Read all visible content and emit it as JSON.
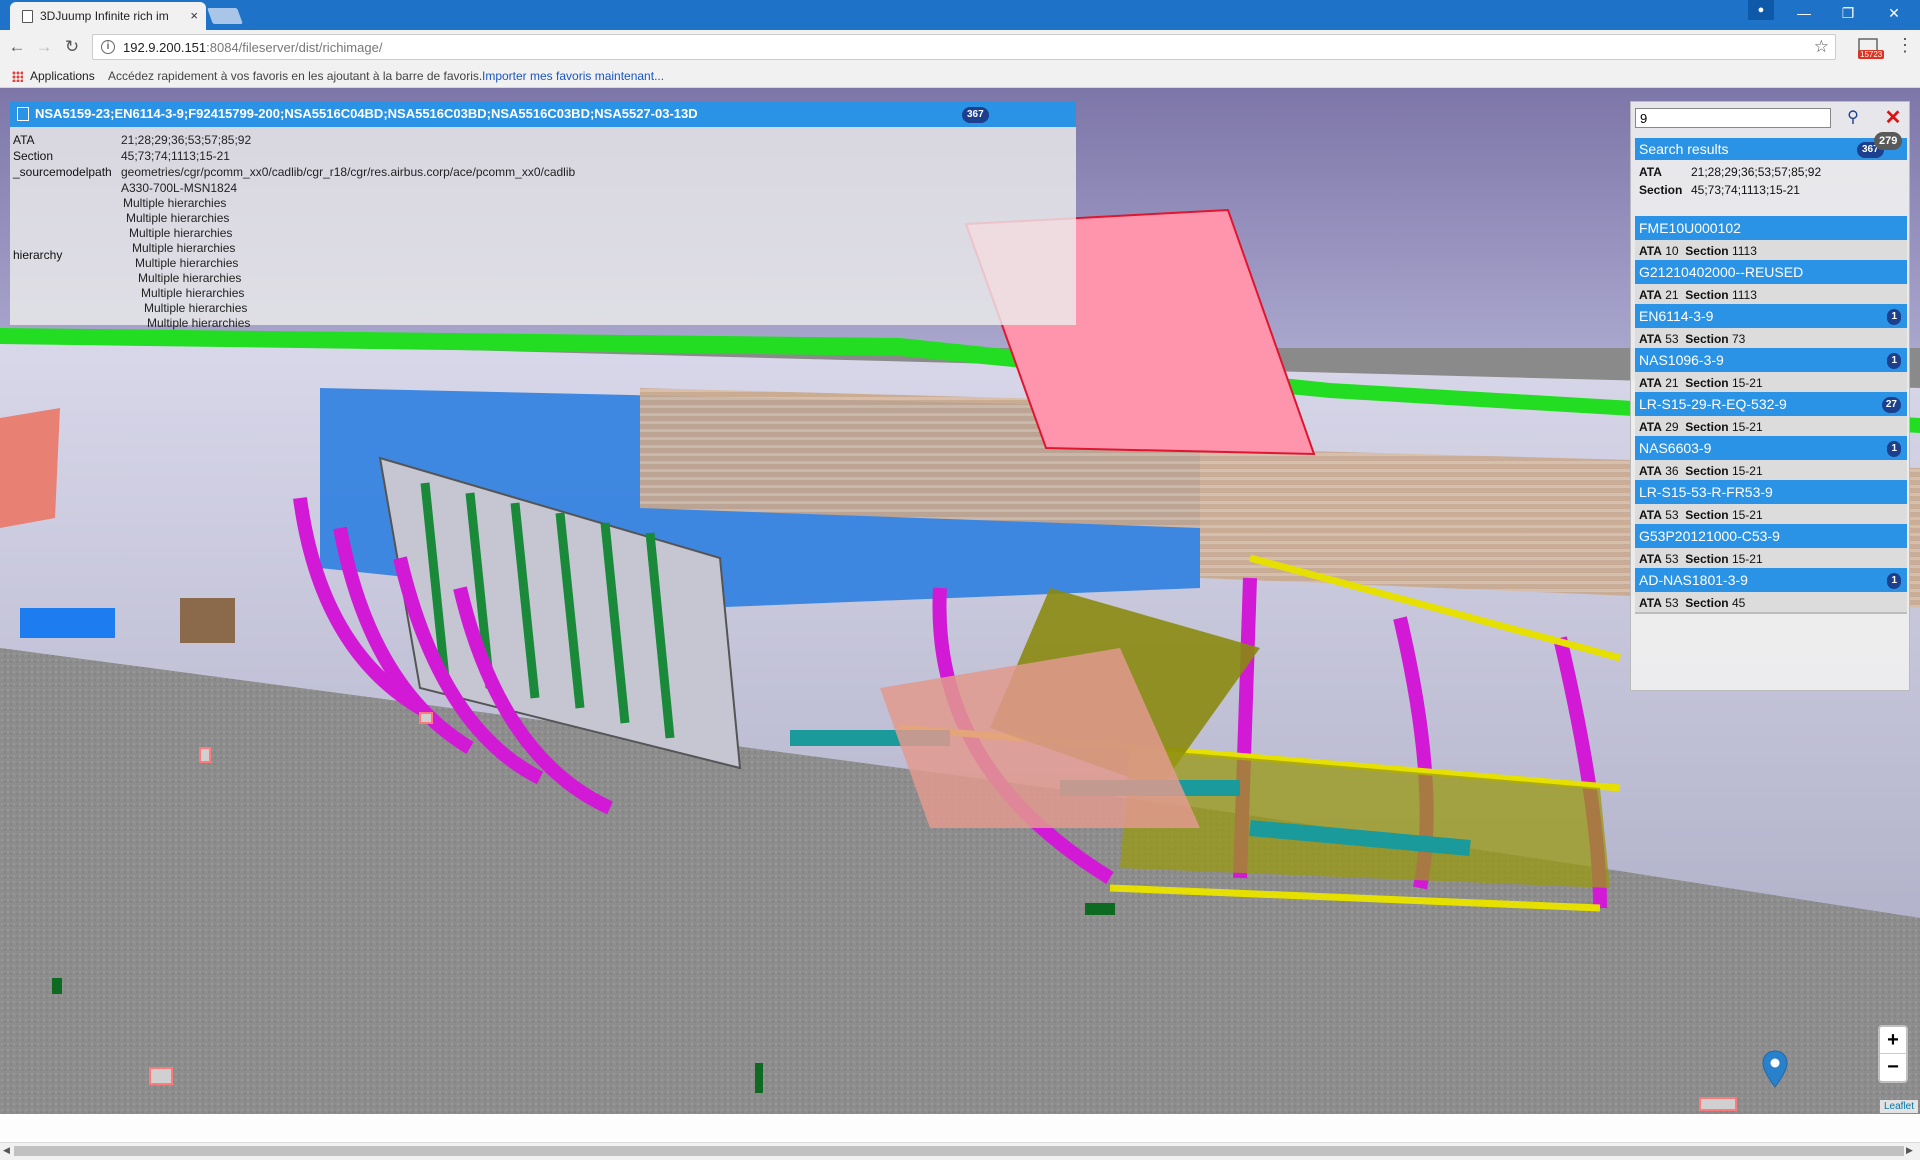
{
  "browser": {
    "tab_title": "3DJuump Infinite rich im",
    "tab_close": "×",
    "url_host": "192.9.200.151",
    "url_rest": ":8084/fileserver/dist/richimage/",
    "cast_badge": "15723",
    "bookmarks_apps": "Applications",
    "bookmarks_hint": "Accédez rapidement à vos favoris en les ajoutant à la barre de favoris.",
    "bookmarks_link": "Importer mes favoris maintenant...",
    "icons": [
      "back-arrow-icon",
      "forward-arrow-icon",
      "reload-icon",
      "info-icon",
      "star-icon",
      "cast-icon",
      "menu-dots-icon",
      "apps-grid-icon"
    ]
  },
  "attributes": {
    "title": "NSA5159-23;EN6114-3-9;F92415799-200;NSA5516C04BD;NSA5516C03BD;NSA5516C03BD;NSA5527-03-13D",
    "count": "367",
    "ata_label": "ATA",
    "ata_value": "21;28;29;36;53;57;85;92",
    "section_label": "Section",
    "section_value": "45;73;74;1113;15-21",
    "source_label": "_sourcemodelpath",
    "source_value": "geometries/cgr/pcomm_xx0/cadlib/cgr_r18/cgr/res.airbus.corp/ace/pcomm_xx0/cadlib",
    "hierarchy_label": "hierarchy",
    "hierarchy_root": "A330-700L-MSN1824",
    "hierarchy_items": [
      "Multiple hierarchies",
      "Multiple hierarchies",
      "Multiple hierarchies",
      "Multiple hierarchies",
      "Multiple hierarchies",
      "Multiple hierarchies",
      "Multiple hierarchies",
      "Multiple hierarchies",
      "Multiple hierarchies"
    ]
  },
  "search": {
    "query": "9",
    "go_icon": "magnifier-icon",
    "close_icon": "close-x-icon",
    "total_badge": "279",
    "results_label": "Search results",
    "results_count": "367",
    "summary_ata_label": "ATA",
    "summary_ata_value": "21;28;29;36;53;57;85;92",
    "summary_section_label": "Section",
    "summary_section_value": "45;73;74;1113;15-21",
    "ata_label": "ATA",
    "section_label": "Section",
    "results": [
      {
        "title": "FME10U000102",
        "ata": "10",
        "section": "1113",
        "badge": ""
      },
      {
        "title": "G21210402000--REUSED",
        "ata": "21",
        "section": "1113",
        "badge": ""
      },
      {
        "title": "EN6114-3-9",
        "ata": "53",
        "section": "73",
        "badge": "1"
      },
      {
        "title": "NAS1096-3-9",
        "ata": "21",
        "section": "15-21",
        "badge": "1"
      },
      {
        "title": "LR-S15-29-R-EQ-532-9",
        "ata": "29",
        "section": "15-21",
        "badge": "27"
      },
      {
        "title": "NAS6603-9",
        "ata": "36",
        "section": "15-21",
        "badge": "1"
      },
      {
        "title": "LR-S15-53-R-FR53-9",
        "ata": "53",
        "section": "15-21",
        "badge": ""
      },
      {
        "title": "G53P20121000-C53-9",
        "ata": "53",
        "section": "15-21",
        "badge": ""
      },
      {
        "title": "AD-NAS1801-3-9",
        "ata": "53",
        "section": "45",
        "badge": "1"
      }
    ]
  },
  "map": {
    "zoom_in": "+",
    "zoom_out": "−",
    "attribution": "Leaflet",
    "marker_icon": "map-pin-icon"
  },
  "colors": {
    "accent": "#2b93e6",
    "badge": "#1c3f8e",
    "magenta": "#d21ad6",
    "fuselage": "#c9c9dc",
    "ground": "#8c8c8c"
  }
}
